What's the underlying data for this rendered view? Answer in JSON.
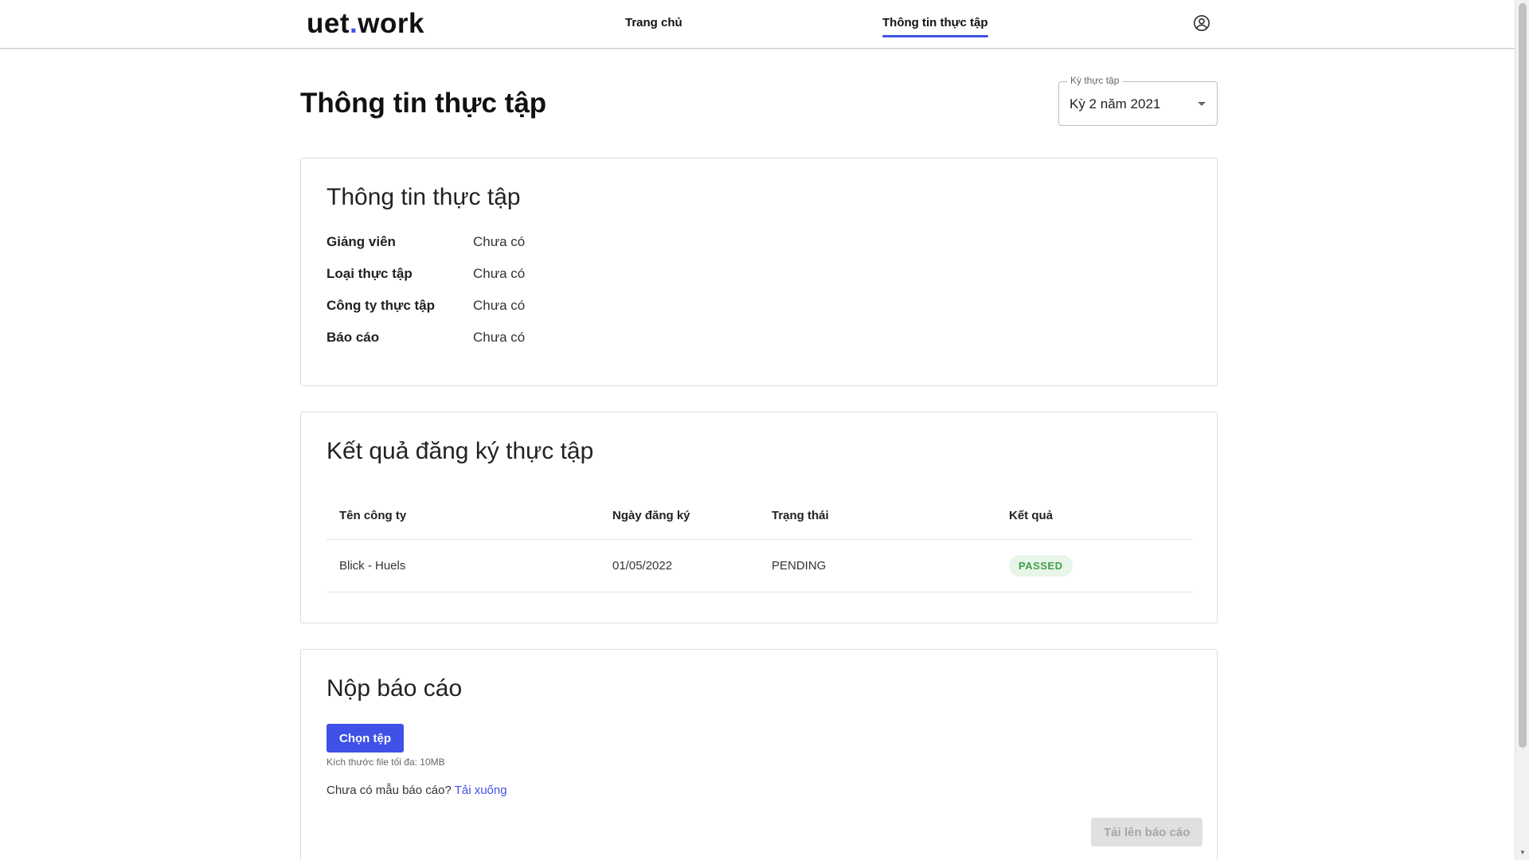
{
  "header": {
    "logo_part1": "uet",
    "logo_dot": ".",
    "logo_part2": "work",
    "nav": {
      "home": "Trang chủ",
      "internship_info": "Thông tin thực tập"
    }
  },
  "page": {
    "title": "Thông tin thực tập",
    "term_select": {
      "label": "Kỳ thực tập",
      "value": "Kỳ 2 năm 2021"
    }
  },
  "info_card": {
    "title": "Thông tin thực tập",
    "rows": [
      {
        "label": "Giảng viên",
        "value": "Chưa có"
      },
      {
        "label": "Loại thực tập",
        "value": "Chưa có"
      },
      {
        "label": "Công ty thực tập",
        "value": "Chưa có"
      },
      {
        "label": "Báo cáo",
        "value": "Chưa có"
      }
    ]
  },
  "result_card": {
    "title": "Kết quả đăng ký thực tập",
    "columns": [
      "Tên công ty",
      "Ngày đăng ký",
      "Trạng thái",
      "Kết quả"
    ],
    "rows": [
      {
        "company": "Blick - Huels",
        "date": "01/05/2022",
        "status": "PENDING",
        "result": "PASSED"
      }
    ]
  },
  "upload_card": {
    "title": "Nộp báo cáo",
    "choose_button": "Chọn tệp",
    "size_hint": "Kích thước file tối đa: 10MB",
    "template_question": "Chưa có mẫu báo cáo?",
    "template_link": "Tải xuống",
    "submit_button": "Tải lên báo cáo"
  },
  "colors": {
    "accent": "#3f51e6",
    "badge_bg": "#e8f5e9",
    "badge_text": "#43a047"
  }
}
